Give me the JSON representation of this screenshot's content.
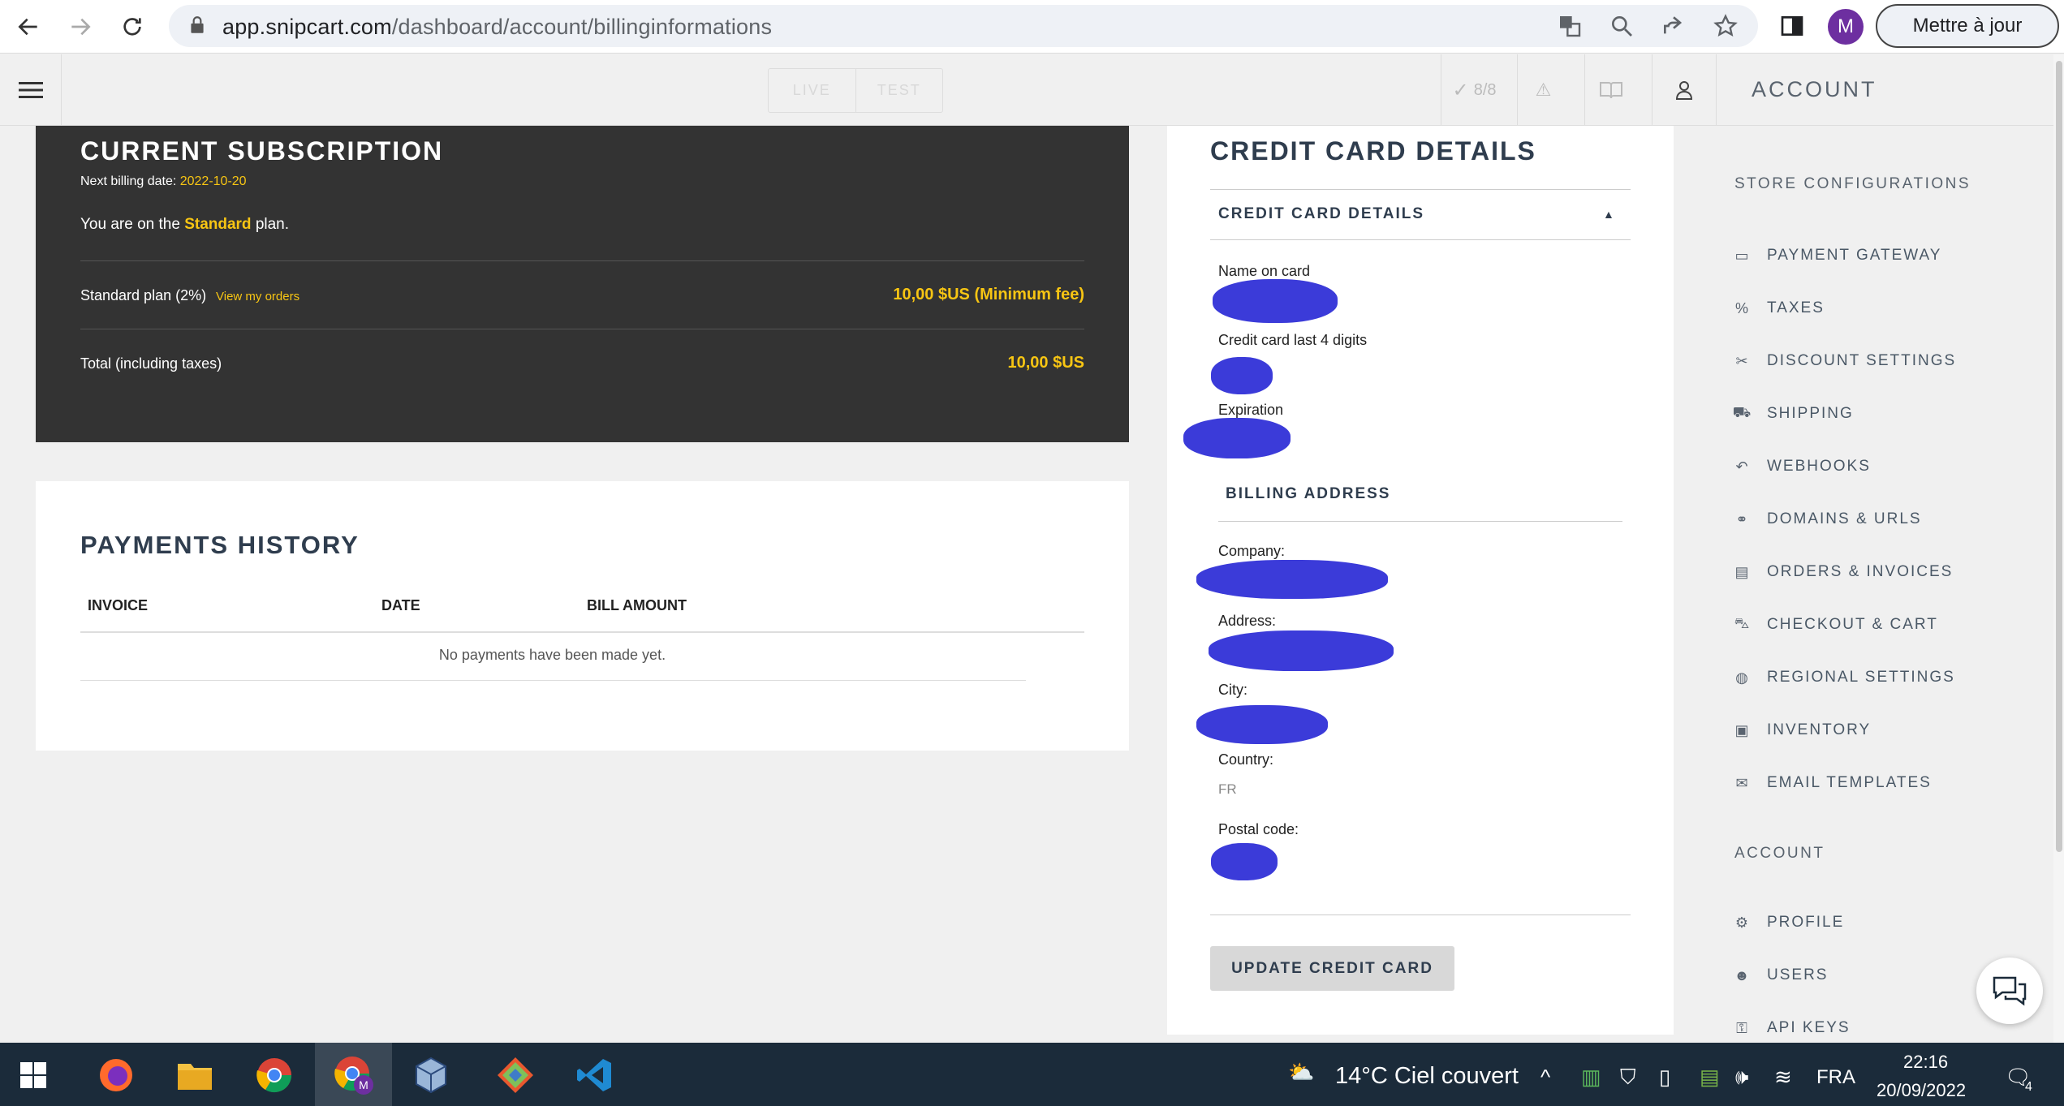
{
  "browser": {
    "url_host": "app.snipcart.com",
    "url_path": "/dashboard/account/billinginformations",
    "avatar_letter": "M",
    "update_button": "Mettre à jour"
  },
  "header": {
    "env_live": "LIVE",
    "env_test": "TEST",
    "checklist": "8/8",
    "title": "ACCOUNT"
  },
  "subscription": {
    "title": "CURRENT SUBSCRIPTION",
    "next_billing_label": "Next billing date: ",
    "next_billing_date": "2022-10-20",
    "plan_prefix": "You are on the ",
    "plan_name": "Standard",
    "plan_suffix": " plan.",
    "row1_label": "Standard plan (2%)",
    "row1_link": "View my orders",
    "row1_value": "10,00 $US (Minimum fee)",
    "row2_label": "Total (including taxes)",
    "row2_value": "10,00 $US"
  },
  "payments": {
    "title": "PAYMENTS HISTORY",
    "columns": [
      "INVOICE",
      "DATE",
      "BILL AMOUNT"
    ],
    "empty_message": "No payments have been made yet."
  },
  "credit_card": {
    "title": "CREDIT CARD DETAILS",
    "section_title": "CREDIT CARD DETAILS",
    "name_label": "Name on card",
    "digits_label": "Credit card last 4 digits",
    "expiration_label": "Expiration",
    "billing_title": "BILLING ADDRESS",
    "company_label": "Company:",
    "address_label": "Address:",
    "city_label": "City:",
    "country_label": "Country:",
    "country_value": "FR",
    "postal_label": "Postal code:",
    "update_button": "UPDATE CREDIT CARD"
  },
  "sidebar": {
    "store_heading": "STORE CONFIGURATIONS",
    "store_items": [
      {
        "label": "PAYMENT GATEWAY",
        "icon": "credit-card-icon"
      },
      {
        "label": "TAXES",
        "icon": "percent-icon"
      },
      {
        "label": "DISCOUNT SETTINGS",
        "icon": "scissors-icon"
      },
      {
        "label": "SHIPPING",
        "icon": "truck-icon"
      },
      {
        "label": "WEBHOOKS",
        "icon": "undo-icon"
      },
      {
        "label": "DOMAINS & URLS",
        "icon": "link-icon"
      },
      {
        "label": "ORDERS & INVOICES",
        "icon": "receipt-icon"
      },
      {
        "label": "CHECKOUT & CART",
        "icon": "cart-icon"
      },
      {
        "label": "REGIONAL SETTINGS",
        "icon": "globe-icon"
      },
      {
        "label": "INVENTORY",
        "icon": "box-icon"
      },
      {
        "label": "EMAIL TEMPLATES",
        "icon": "envelope-icon"
      }
    ],
    "account_heading": "ACCOUNT",
    "account_items": [
      {
        "label": "PROFILE",
        "icon": "gear-icon"
      },
      {
        "label": "USERS",
        "icon": "users-icon"
      },
      {
        "label": "API KEYS",
        "icon": "key-icon"
      }
    ]
  },
  "taskbar": {
    "weather": "14°C  Ciel couvert",
    "language": "FRA",
    "time": "22:16",
    "date": "20/09/2022",
    "notifications": "4"
  },
  "colors": {
    "accent": "#f7c513",
    "dark_card": "#333333",
    "heading": "#2f3d4e",
    "redaction": "#3b3bd9"
  }
}
